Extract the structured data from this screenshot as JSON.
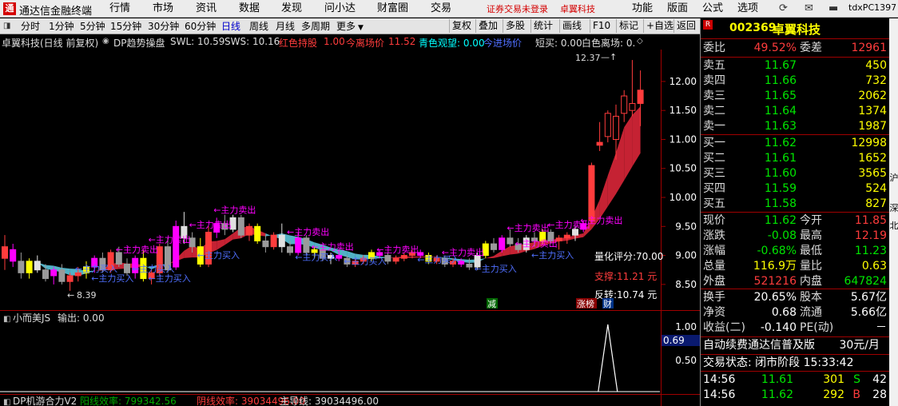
{
  "app": {
    "title": "通达信金融终端",
    "logo_char": "通",
    "menus": [
      "行情",
      "市场",
      "资讯",
      "数据",
      "发现",
      "问小达",
      "财富圈",
      "交易"
    ],
    "login_status": "证券交易未登录",
    "stock_name_header": "卓翼科技",
    "right_menus": [
      "功能",
      "版面",
      "公式",
      "选项"
    ],
    "user_id": "tdxPC1397"
  },
  "toolbar": {
    "periods": [
      "分时",
      "1分钟",
      "5分钟",
      "15分钟",
      "30分钟",
      "60分钟",
      "日线",
      "周线",
      "月线",
      "多周期",
      "更多"
    ],
    "active_period": "日线",
    "buttons": [
      "复权",
      "叠加",
      "多股",
      "统计",
      "画线",
      "F10",
      "标记",
      "+自选",
      "返回"
    ]
  },
  "chart_header": {
    "title": "卓翼科技(日线 前复权)",
    "indicator": "DP趋势操盘",
    "swl": "SWL: 10.59",
    "sws": "SWS: 10.16",
    "hold_label": "红色持股",
    "hold_val": "1.00",
    "leave_label": "今离场价",
    "leave_val": "11.52",
    "watch": "青色观望: 0.00",
    "enter": "今进场价",
    "short_sell": "短买: 0.00",
    "white_leave": "白色离场: 0."
  },
  "chart_data": {
    "type": "candlestick",
    "title": "卓翼科技(日线 前复权)",
    "ylim": [
      8.25,
      12.55
    ],
    "yticks": [
      12.0,
      11.5,
      11.0,
      10.5,
      10.0,
      9.5,
      9.0,
      8.5
    ],
    "high_mark": "12.37",
    "low_mark": "8.39",
    "candles": [
      [
        8.95,
        9.35,
        8.75,
        9.15
      ],
      [
        9.1,
        9.2,
        8.8,
        8.9
      ],
      [
        8.9,
        9.05,
        8.6,
        8.7
      ],
      [
        8.7,
        8.95,
        8.6,
        8.9
      ],
      [
        8.9,
        9.0,
        8.7,
        8.75
      ],
      [
        8.75,
        8.85,
        8.55,
        8.6
      ],
      [
        8.65,
        8.8,
        8.5,
        8.75
      ],
      [
        8.75,
        8.85,
        8.5,
        8.55
      ],
      [
        8.55,
        8.7,
        8.39,
        8.65
      ],
      [
        8.65,
        8.8,
        8.55,
        8.7
      ],
      [
        8.7,
        8.9,
        8.6,
        8.8
      ],
      [
        8.8,
        9.0,
        8.7,
        8.95
      ],
      [
        8.95,
        9.05,
        8.7,
        8.75
      ],
      [
        8.75,
        9.1,
        8.7,
        9.05
      ],
      [
        9.05,
        9.15,
        8.8,
        8.85
      ],
      [
        8.85,
        8.95,
        8.65,
        8.7
      ],
      [
        8.7,
        9.0,
        8.6,
        8.95
      ],
      [
        8.95,
        9.1,
        8.55,
        8.6
      ],
      [
        8.6,
        8.75,
        8.5,
        8.7
      ],
      [
        8.7,
        9.2,
        8.65,
        9.15
      ],
      [
        9.15,
        9.3,
        8.7,
        8.75
      ],
      [
        8.8,
        9.6,
        8.75,
        9.5
      ],
      [
        9.5,
        9.75,
        9.2,
        9.3
      ],
      [
        9.3,
        9.4,
        9.05,
        9.15
      ],
      [
        9.15,
        9.3,
        8.8,
        8.85
      ],
      [
        8.85,
        9.5,
        8.8,
        9.4
      ],
      [
        9.4,
        9.65,
        9.3,
        9.55
      ],
      [
        9.55,
        9.7,
        9.35,
        9.45
      ],
      [
        9.45,
        9.7,
        9.4,
        9.65
      ],
      [
        9.65,
        9.7,
        9.3,
        9.35
      ],
      [
        9.35,
        9.55,
        9.25,
        9.5
      ],
      [
        9.5,
        9.55,
        9.2,
        9.25
      ],
      [
        9.25,
        9.35,
        9.05,
        9.15
      ],
      [
        9.15,
        9.4,
        9.1,
        9.35
      ],
      [
        9.35,
        9.55,
        9.05,
        9.15
      ],
      [
        9.15,
        9.25,
        9.0,
        9.05
      ],
      [
        9.05,
        9.4,
        9.0,
        9.3
      ],
      [
        9.3,
        9.35,
        9.0,
        9.05
      ],
      [
        9.05,
        9.15,
        8.95,
        9.1
      ],
      [
        9.1,
        9.15,
        8.9,
        8.95
      ],
      [
        8.95,
        9.05,
        8.85,
        9.0
      ],
      [
        9.0,
        9.1,
        8.9,
        8.95
      ],
      [
        8.95,
        9.0,
        8.8,
        8.85
      ],
      [
        8.85,
        8.95,
        8.8,
        8.9
      ],
      [
        8.9,
        9.0,
        8.85,
        8.95
      ],
      [
        8.95,
        9.1,
        8.9,
        9.05
      ],
      [
        9.05,
        9.1,
        8.95,
        9.0
      ],
      [
        9.0,
        9.05,
        8.85,
        8.9
      ],
      [
        8.9,
        9.0,
        8.85,
        8.95
      ],
      [
        8.95,
        9.05,
        8.9,
        9.0
      ],
      [
        9.0,
        9.1,
        8.95,
        9.05
      ],
      [
        9.05,
        9.1,
        8.95,
        9.0
      ],
      [
        9.0,
        9.05,
        8.85,
        8.9
      ],
      [
        8.9,
        9.0,
        8.85,
        8.95
      ],
      [
        8.95,
        9.0,
        8.8,
        8.85
      ],
      [
        8.85,
        8.95,
        8.8,
        8.9
      ],
      [
        8.9,
        8.95,
        8.8,
        8.85
      ],
      [
        8.85,
        8.95,
        8.75,
        8.8
      ],
      [
        8.8,
        9.05,
        8.75,
        9.0
      ],
      [
        9.0,
        9.25,
        8.95,
        9.2
      ],
      [
        9.2,
        9.3,
        9.05,
        9.1
      ],
      [
        9.1,
        9.35,
        9.05,
        9.3
      ],
      [
        9.3,
        9.45,
        9.15,
        9.2
      ],
      [
        9.2,
        9.3,
        9.05,
        9.1
      ],
      [
        9.1,
        9.35,
        9.05,
        9.3
      ],
      [
        9.3,
        9.4,
        9.15,
        9.25
      ],
      [
        9.25,
        9.45,
        9.2,
        9.4
      ],
      [
        9.4,
        9.45,
        9.2,
        9.25
      ],
      [
        9.25,
        9.35,
        9.1,
        9.3
      ],
      [
        9.3,
        9.4,
        9.2,
        9.35
      ],
      [
        9.35,
        9.5,
        9.25,
        9.45
      ],
      [
        9.45,
        9.6,
        9.4,
        9.55
      ],
      [
        9.6,
        10.6,
        9.55,
        10.55
      ],
      [
        10.95,
        11.3,
        10.8,
        10.9
      ],
      [
        11.05,
        11.5,
        10.95,
        11.45
      ],
      [
        11.0,
        11.6,
        10.65,
        11.4
      ],
      [
        11.45,
        11.85,
        11.3,
        11.75
      ],
      [
        11.5,
        12.37,
        11.4,
        11.62
      ],
      [
        11.85,
        12.19,
        11.23,
        11.62
      ]
    ],
    "signals": [
      {
        "text": "←主力卖出",
        "sell": true,
        "i": 14,
        "y": 9.05
      },
      {
        "text": "←主力卖出",
        "sell": true,
        "i": 18,
        "y": 9.22
      },
      {
        "text": "←主力卖出",
        "sell": true,
        "i": 23,
        "y": 9.48
      },
      {
        "text": "←主力卖出",
        "sell": true,
        "i": 26,
        "y": 9.73
      },
      {
        "text": "←主力卖出",
        "sell": true,
        "i": 35,
        "y": 9.35
      },
      {
        "text": "←主力卖出",
        "sell": true,
        "i": 38,
        "y": 9.1
      },
      {
        "text": "←主力卖出",
        "sell": true,
        "i": 46,
        "y": 9.05
      },
      {
        "text": "←主力卖出",
        "sell": true,
        "i": 54,
        "y": 9.0
      },
      {
        "text": "←主力卖出",
        "sell": true,
        "i": 62,
        "y": 9.42
      },
      {
        "text": "←主力卖出",
        "sell": true,
        "i": 67,
        "y": 9.48
      },
      {
        "text": "←主力卖出",
        "sell": true,
        "i": 71,
        "y": 9.55
      },
      {
        "text": "←主力卖出",
        "sell": true,
        "i": 63,
        "y": 9.15
      },
      {
        "text": "←主力买入",
        "sell": false,
        "i": 9,
        "y": 8.72
      },
      {
        "text": "←主力买入",
        "sell": false,
        "i": 11,
        "y": 8.55
      },
      {
        "text": "←主力买入",
        "sell": false,
        "i": 16,
        "y": 8.72
      },
      {
        "text": "←主力买入",
        "sell": false,
        "i": 18,
        "y": 8.55
      },
      {
        "text": "←主力买入",
        "sell": false,
        "i": 24,
        "y": 8.95
      },
      {
        "text": "←主力买入",
        "sell": false,
        "i": 36,
        "y": 8.92
      },
      {
        "text": "←主力买入",
        "sell": false,
        "i": 42,
        "y": 8.85
      },
      {
        "text": "←主力买入",
        "sell": false,
        "i": 51,
        "y": 8.88
      },
      {
        "text": "←主力买入",
        "sell": false,
        "i": 58,
        "y": 8.72
      },
      {
        "text": "←主力买入",
        "sell": false,
        "i": 65,
        "y": 8.95
      }
    ],
    "rating": "量化评分:70.00",
    "support": "支撑:11.21 元",
    "reversal": "反转:10.74 元",
    "bottom_labels": {
      "jian": "减",
      "zhangting": "涨榜",
      "cai": "财"
    }
  },
  "sub1": {
    "title": "小而美JS",
    "output": "输出: 0.00",
    "yticks": [
      "1.00",
      "0.50"
    ],
    "current": "0.69",
    "spike_index": 74
  },
  "sub2": {
    "title": "DP机游合力V2",
    "yang": "阳线效率: 799342.56",
    "yin": "阴线效率: 39034496.00",
    "main": "主导线: 39034496.00"
  },
  "quote": {
    "code": "002369",
    "name": "卓翼科技",
    "weibi_label": "委比",
    "weibi": "49.52%",
    "weicha_label": "委差",
    "weicha": "12961",
    "sell": [
      {
        "label": "卖五",
        "price": "11.67",
        "vol": "450"
      },
      {
        "label": "卖四",
        "price": "11.66",
        "vol": "732"
      },
      {
        "label": "卖三",
        "price": "11.65",
        "vol": "2062"
      },
      {
        "label": "卖二",
        "price": "11.64",
        "vol": "1374"
      },
      {
        "label": "卖一",
        "price": "11.63",
        "vol": "1987"
      }
    ],
    "buy": [
      {
        "label": "买一",
        "price": "11.62",
        "vol": "12998"
      },
      {
        "label": "买二",
        "price": "11.61",
        "vol": "1652"
      },
      {
        "label": "买三",
        "price": "11.60",
        "vol": "3565"
      },
      {
        "label": "买四",
        "price": "11.59",
        "vol": "524"
      },
      {
        "label": "买五",
        "price": "11.58",
        "vol": "827"
      }
    ],
    "stats": [
      {
        "l1": "现价",
        "v1": "11.62",
        "c1": "green",
        "l2": "今开",
        "v2": "11.85",
        "c2": "red"
      },
      {
        "l1": "涨跌",
        "v1": "-0.08",
        "c1": "green",
        "l2": "最高",
        "v2": "12.19",
        "c2": "red"
      },
      {
        "l1": "涨幅",
        "v1": "-0.68%",
        "c1": "green",
        "l2": "最低",
        "v2": "11.23",
        "c2": "green"
      },
      {
        "l1": "总量",
        "v1": "116.9万",
        "c1": "yellow",
        "l2": "量比",
        "v2": "0.63",
        "c2": "yellow"
      },
      {
        "l1": "外盘",
        "v1": "521216",
        "c1": "red",
        "l2": "内盘",
        "v2": "647824",
        "c2": "green"
      }
    ],
    "stats2": [
      {
        "l1": "换手",
        "v1": "20.65%",
        "l2": "股本",
        "v2": "5.67亿"
      },
      {
        "l1": "净资",
        "v1": "0.68",
        "l2": "流通",
        "v2": "5.66亿"
      },
      {
        "l1": "收益(二)",
        "v1": "-0.140",
        "l2": "PE(动)",
        "v2": "－"
      }
    ],
    "promo": "自动续费通达信普及版",
    "promo_price": "30元/月",
    "trade_status": "交易状态: 闭市阶段 15:33:42",
    "ticks": [
      {
        "time": "14:56",
        "price": "11.61",
        "vol": "301",
        "flag": "S",
        "count": "42"
      },
      {
        "time": "14:56",
        "price": "11.62",
        "vol": "292",
        "flag": "B",
        "count": "28"
      }
    ],
    "side_tabs": [
      "沪",
      "深",
      "北"
    ],
    "r_badge": "R"
  },
  "colors": {
    "up": "#ff3c3c",
    "down": "#00e600",
    "yellow": "#ffff00",
    "magenta": "#ff00ff",
    "cyan": "#00ffff",
    "axis": "#a00000"
  }
}
